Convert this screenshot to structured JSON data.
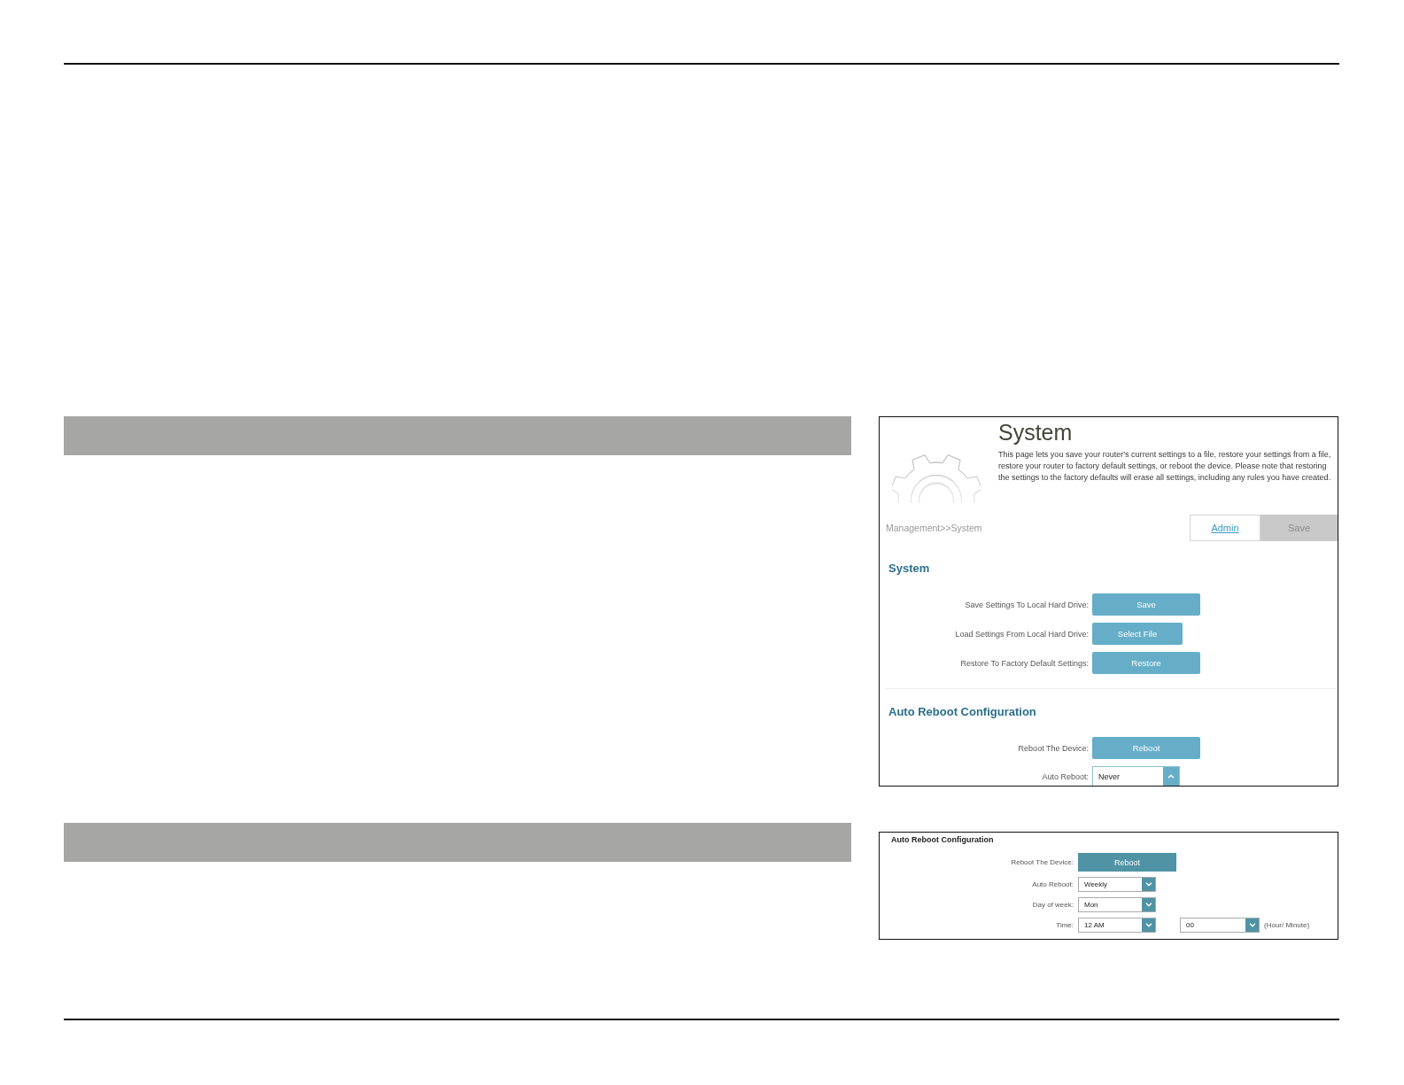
{
  "sections": [
    {
      "kind": "system_page",
      "screen": {
        "title": "System",
        "description": "This page lets you save your router's current settings to a file, restore your settings from a file, restore your router to factory default settings, or reboot the device. Please note that restoring the settings to the factory defaults will erase all settings, including any rules you have created.",
        "breadcrumb": "Management>>System",
        "actions": [
          {
            "kind": "link",
            "label": "Admin"
          },
          {
            "kind": "button",
            "label": "Save",
            "disabled": true
          }
        ],
        "groups": [
          {
            "heading": "System",
            "rows": [
              {
                "kind": "button",
                "label": "Save Settings To Local Hard Drive:",
                "button": "Save"
              },
              {
                "kind": "file_button",
                "label": "Load Settings From Local Hard Drive:",
                "button": "Select File"
              },
              {
                "kind": "button",
                "label": "Restore To Factory Default Settings:",
                "button": "Restore"
              }
            ]
          },
          {
            "heading": "Auto Reboot Configuration",
            "rows": [
              {
                "kind": "button",
                "label": "Reboot The Device:",
                "button": "Reboot"
              },
              {
                "kind": "select",
                "label": "Auto Reboot:",
                "selects": [
                  {
                    "value": "Never",
                    "expanded": true
                  }
                ]
              }
            ]
          }
        ]
      }
    },
    {
      "kind": "auto_reboot_panel",
      "screen": {
        "groups": [
          {
            "heading": "Auto Reboot Configuration",
            "rows": [
              {
                "kind": "button",
                "label": "Reboot The Device:",
                "button": "Reboot"
              },
              {
                "kind": "select",
                "label": "Auto Reboot:",
                "selects": [
                  {
                    "value": "Weekly",
                    "expanded": false
                  }
                ]
              },
              {
                "kind": "select",
                "label": "Day of week:",
                "selects": [
                  {
                    "value": "Mon",
                    "expanded": false
                  }
                ]
              },
              {
                "kind": "select",
                "label": "Time:",
                "selects": [
                  {
                    "value": "12 AM",
                    "expanded": false
                  },
                  {
                    "value": "00",
                    "expanded": false
                  }
                ],
                "note": "(Hour/ Minute)"
              }
            ]
          }
        ]
      }
    }
  ]
}
